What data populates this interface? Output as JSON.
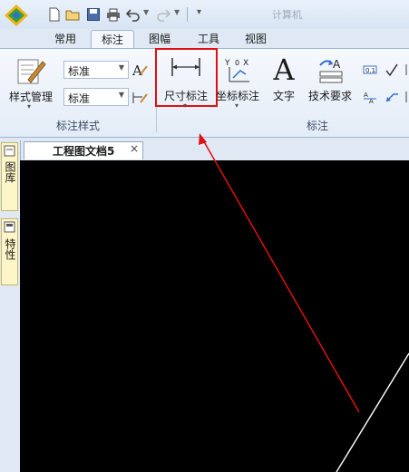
{
  "quick_access": {
    "items": [
      "new-file-icon",
      "open-folder-icon",
      "save-icon",
      "print-icon",
      "undo-icon",
      "redo-icon",
      "customize-icon"
    ]
  },
  "app_name": "计算机",
  "tabs": [
    {
      "label": "常用"
    },
    {
      "label": "标注"
    },
    {
      "label": "图幅"
    },
    {
      "label": "工具"
    },
    {
      "label": "视图"
    }
  ],
  "active_tab": "标注",
  "ribbon": {
    "style_group": {
      "manage_label": "样式管理",
      "dropdown1_value": "标准",
      "dropdown2_value": "标准",
      "group_label": "标注样式"
    },
    "annot_group": {
      "dimension_label": "尺寸标注",
      "coord_label": "坐标标注",
      "text_label": "文字",
      "text_glyph": "A",
      "tech_label": "技术要求",
      "group_label": "标注"
    }
  },
  "document": {
    "tab_label": "工程图文档5",
    "close_glyph": "×"
  },
  "side_panel": {
    "tab1_label": "图库",
    "tab2_label": "特性"
  },
  "colors": {
    "highlight": "#e01010",
    "arrow": "#e01010",
    "canvas": "#000000",
    "canvas_line": "#ffffff"
  }
}
